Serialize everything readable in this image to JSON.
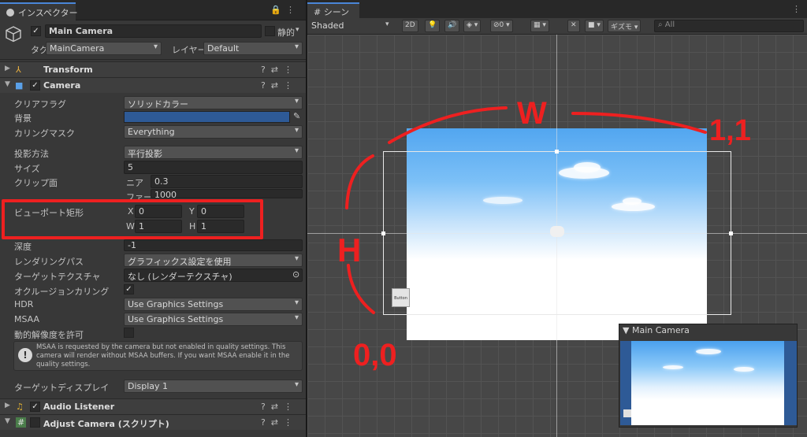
{
  "inspector": {
    "tab_label": "インスペクター",
    "tab_icons": "🔒⋮",
    "object_name": "Main Camera",
    "static_label": "静的",
    "tag_label": "タグ",
    "tag_value": "MainCamera",
    "layer_label": "レイヤー",
    "layer_value": "Default",
    "component_icons": "?⇄⋮",
    "components": {
      "transform": "Transform",
      "camera": "Camera",
      "audio_listener": "Audio Listener",
      "adjust_camera": "Adjust Camera (スクリプト)"
    },
    "camera": {
      "clear_flags_label": "クリアフラグ",
      "clear_flags_value": "ソリッドカラー",
      "background_label": "背景",
      "background_color": "#2e5a96",
      "culling_label": "カリングマスク",
      "culling_value": "Everything",
      "projection_label": "投影方法",
      "projection_value": "平行投影",
      "size_label": "サイズ",
      "size_value": "5",
      "clip_label": "クリップ面",
      "near_label": "ニア",
      "near_value": "0.3",
      "far_label": "ファー",
      "far_value": "1000",
      "viewport_label": "ビューポート矩形",
      "vx_label": "X",
      "vx_value": "0",
      "vy_label": "Y",
      "vy_value": "0",
      "vw_label": "W",
      "vw_value": "1",
      "vh_label": "H",
      "vh_value": "1",
      "depth_label": "深度",
      "depth_value": "-1",
      "render_path_label": "レンダリングパス",
      "render_path_value": "グラフィックス設定を使用",
      "target_texture_label": "ターゲットテクスチャ",
      "target_texture_value": "なし (レンダーテクスチャ)",
      "occlusion_label": "オクルージョンカリング",
      "hdr_label": "HDR",
      "hdr_value": "Use Graphics Settings",
      "msaa_label": "MSAA",
      "msaa_value": "Use Graphics Settings",
      "dynamic_res_label": "動的解像度を許可",
      "help_text": "MSAA is requested by the camera but not enabled in quality settings. This camera will render without MSAA buffers. If you want MSAA enable it in the quality settings.",
      "target_display_label": "ターゲットディスプレイ",
      "target_display_value": "Display 1"
    }
  },
  "scene": {
    "tab_label": "シーン",
    "tab_icon": "#",
    "shading_mode": "Shaded",
    "btn_2d": "2D",
    "hidden_count": "0",
    "gizmos_label": "ギズモ",
    "search_placeholder": "All",
    "button_label": "Button",
    "preview_title": "Main Camera",
    "annotations": {
      "w": "W",
      "h": "H",
      "top_right": "1,1",
      "bottom_left": "0,0"
    },
    "colors": {
      "annotation": "#ee2020",
      "sky_top": "#52a6f0"
    }
  }
}
